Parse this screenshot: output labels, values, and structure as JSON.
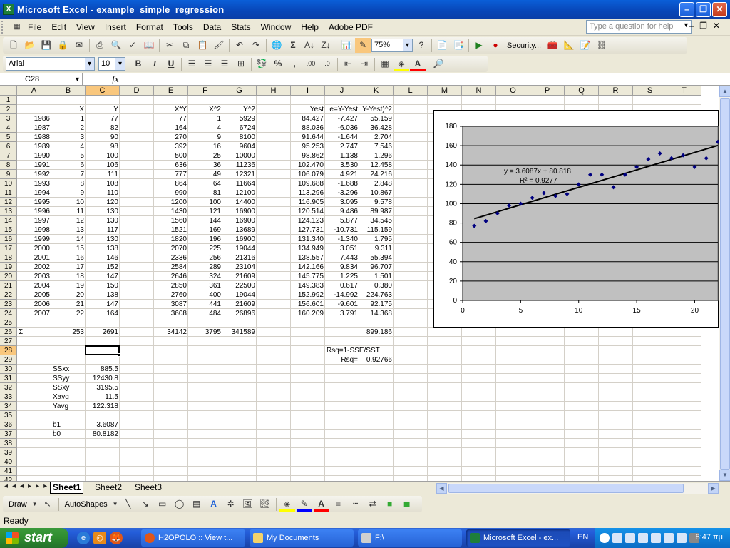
{
  "window": {
    "title": "Microsoft Excel - example_simple_regression"
  },
  "menu": {
    "items": [
      "File",
      "Edit",
      "View",
      "Insert",
      "Format",
      "Tools",
      "Data",
      "Stats",
      "Window",
      "Help",
      "Adobe PDF"
    ],
    "help_placeholder": "Type a question for help"
  },
  "toolbar": {
    "zoom": "75%",
    "security_label": "Security...",
    "font_name": "Arial",
    "font_size": "10"
  },
  "formula_bar": {
    "name_box": "C28",
    "fx_label": "fx",
    "formula": ""
  },
  "sheet": {
    "columns": [
      "A",
      "B",
      "C",
      "D",
      "E",
      "F",
      "G",
      "H",
      "I",
      "J",
      "K",
      "L",
      "M",
      "N",
      "O",
      "P",
      "Q",
      "R",
      "S",
      "T"
    ],
    "active_col": "C",
    "active_row": 28,
    "rows": {
      "2": {
        "B": "X",
        "C": "Y",
        "E": "X*Y",
        "F": "X^2",
        "G": "Y^2",
        "I": "Yest",
        "J": "e=Y-Yest",
        "K": "Y-Yest)^2"
      },
      "3": {
        "A": "1986",
        "B": "1",
        "C": "77",
        "E": "77",
        "F": "1",
        "G": "5929",
        "I": "84.427",
        "J": "-7.427",
        "K": "55.159"
      },
      "4": {
        "A": "1987",
        "B": "2",
        "C": "82",
        "E": "164",
        "F": "4",
        "G": "6724",
        "I": "88.036",
        "J": "-6.036",
        "K": "36.428"
      },
      "5": {
        "A": "1988",
        "B": "3",
        "C": "90",
        "E": "270",
        "F": "9",
        "G": "8100",
        "I": "91.644",
        "J": "-1.644",
        "K": "2.704"
      },
      "6": {
        "A": "1989",
        "B": "4",
        "C": "98",
        "E": "392",
        "F": "16",
        "G": "9604",
        "I": "95.253",
        "J": "2.747",
        "K": "7.546"
      },
      "7": {
        "A": "1990",
        "B": "5",
        "C": "100",
        "E": "500",
        "F": "25",
        "G": "10000",
        "I": "98.862",
        "J": "1.138",
        "K": "1.296"
      },
      "8": {
        "A": "1991",
        "B": "6",
        "C": "106",
        "E": "636",
        "F": "36",
        "G": "11236",
        "I": "102.470",
        "J": "3.530",
        "K": "12.458"
      },
      "9": {
        "A": "1992",
        "B": "7",
        "C": "111",
        "E": "777",
        "F": "49",
        "G": "12321",
        "I": "106.079",
        "J": "4.921",
        "K": "24.216"
      },
      "10": {
        "A": "1993",
        "B": "8",
        "C": "108",
        "E": "864",
        "F": "64",
        "G": "11664",
        "I": "109.688",
        "J": "-1.688",
        "K": "2.848"
      },
      "11": {
        "A": "1994",
        "B": "9",
        "C": "110",
        "E": "990",
        "F": "81",
        "G": "12100",
        "I": "113.296",
        "J": "-3.296",
        "K": "10.867"
      },
      "12": {
        "A": "1995",
        "B": "10",
        "C": "120",
        "E": "1200",
        "F": "100",
        "G": "14400",
        "I": "116.905",
        "J": "3.095",
        "K": "9.578"
      },
      "13": {
        "A": "1996",
        "B": "11",
        "C": "130",
        "E": "1430",
        "F": "121",
        "G": "16900",
        "I": "120.514",
        "J": "9.486",
        "K": "89.987"
      },
      "14": {
        "A": "1997",
        "B": "12",
        "C": "130",
        "E": "1560",
        "F": "144",
        "G": "16900",
        "I": "124.123",
        "J": "5.877",
        "K": "34.545"
      },
      "15": {
        "A": "1998",
        "B": "13",
        "C": "117",
        "E": "1521",
        "F": "169",
        "G": "13689",
        "I": "127.731",
        "J": "-10.731",
        "K": "115.159"
      },
      "16": {
        "A": "1999",
        "B": "14",
        "C": "130",
        "E": "1820",
        "F": "196",
        "G": "16900",
        "I": "131.340",
        "J": "-1.340",
        "K": "1.795"
      },
      "17": {
        "A": "2000",
        "B": "15",
        "C": "138",
        "E": "2070",
        "F": "225",
        "G": "19044",
        "I": "134.949",
        "J": "3.051",
        "K": "9.311"
      },
      "18": {
        "A": "2001",
        "B": "16",
        "C": "146",
        "E": "2336",
        "F": "256",
        "G": "21316",
        "I": "138.557",
        "J": "7.443",
        "K": "55.394"
      },
      "19": {
        "A": "2002",
        "B": "17",
        "C": "152",
        "E": "2584",
        "F": "289",
        "G": "23104",
        "I": "142.166",
        "J": "9.834",
        "K": "96.707"
      },
      "20": {
        "A": "2003",
        "B": "18",
        "C": "147",
        "E": "2646",
        "F": "324",
        "G": "21609",
        "I": "145.775",
        "J": "1.225",
        "K": "1.501"
      },
      "21": {
        "A": "2004",
        "B": "19",
        "C": "150",
        "E": "2850",
        "F": "361",
        "G": "22500",
        "I": "149.383",
        "J": "0.617",
        "K": "0.380"
      },
      "22": {
        "A": "2005",
        "B": "20",
        "C": "138",
        "E": "2760",
        "F": "400",
        "G": "19044",
        "I": "152.992",
        "J": "-14.992",
        "K": "224.763"
      },
      "23": {
        "A": "2006",
        "B": "21",
        "C": "147",
        "E": "3087",
        "F": "441",
        "G": "21609",
        "I": "156.601",
        "J": "-9.601",
        "K": "92.175"
      },
      "24": {
        "A": "2007",
        "B": "22",
        "C": "164",
        "E": "3608",
        "F": "484",
        "G": "26896",
        "I": "160.209",
        "J": "3.791",
        "K": "14.368"
      },
      "26": {
        "A": "Σ",
        "B": "253",
        "C": "2691",
        "E": "34142",
        "F": "3795",
        "G": "341589",
        "K": "899.186"
      },
      "28": {
        "J": "Rsq=1-SSE/SST"
      },
      "29": {
        "J": "Rsq=",
        "K": "0.92766"
      },
      "30": {
        "B": "SSxx",
        "C": "885.5"
      },
      "31": {
        "B": "SSyy",
        "C": "12430.8"
      },
      "32": {
        "B": "SSxy",
        "C": "3195.5"
      },
      "33": {
        "B": "Xavg",
        "C": "11.5"
      },
      "34": {
        "B": "Yavg",
        "C": "122.318"
      },
      "36": {
        "B": "b1",
        "C": "3.6087"
      },
      "37": {
        "B": "b0",
        "C": "80.8182"
      }
    },
    "left_aligned": {
      "30B": 1,
      "31B": 1,
      "32B": 1,
      "33B": 1,
      "34B": 1,
      "36B": 1,
      "37B": 1,
      "26A": 1
    }
  },
  "chart_data": {
    "type": "scatter",
    "x": [
      1,
      2,
      3,
      4,
      5,
      6,
      7,
      8,
      9,
      10,
      11,
      12,
      13,
      14,
      15,
      16,
      17,
      18,
      19,
      20,
      21,
      22
    ],
    "y": [
      77,
      82,
      90,
      98,
      100,
      106,
      111,
      108,
      110,
      120,
      130,
      130,
      117,
      130,
      138,
      146,
      152,
      147,
      150,
      138,
      147,
      164
    ],
    "trendline": {
      "slope": 3.6087,
      "intercept": 80.818
    },
    "equation_label": "y = 3.6087x + 80.818",
    "r2_label": "R² = 0.9277",
    "xlim": [
      0,
      22
    ],
    "ylim": [
      0,
      180
    ],
    "x_ticks": [
      0,
      5,
      10,
      15,
      20
    ],
    "y_ticks": [
      0,
      20,
      40,
      60,
      80,
      100,
      120,
      140,
      160,
      180
    ],
    "title": "",
    "xlabel": "",
    "ylabel": "",
    "plot_area_color": "#c0c0c0",
    "marker_color": "#000080",
    "grid": true
  },
  "sheet_tabs": [
    "Sheet1",
    "Sheet2",
    "Sheet3"
  ],
  "active_sheet": "Sheet1",
  "drawing": {
    "draw_label": "Draw",
    "autoshapes_label": "AutoShapes"
  },
  "status": {
    "text": "Ready"
  },
  "taskbar": {
    "start_label": "start",
    "tasks": [
      {
        "label": "H2OPOLO :: View t...",
        "active": false
      },
      {
        "label": "My Documents",
        "active": false
      },
      {
        "label": "F:\\",
        "active": false
      },
      {
        "label": "Microsoft Excel - ex...",
        "active": true
      }
    ],
    "language": "EN",
    "clock": "8:47 πμ"
  }
}
